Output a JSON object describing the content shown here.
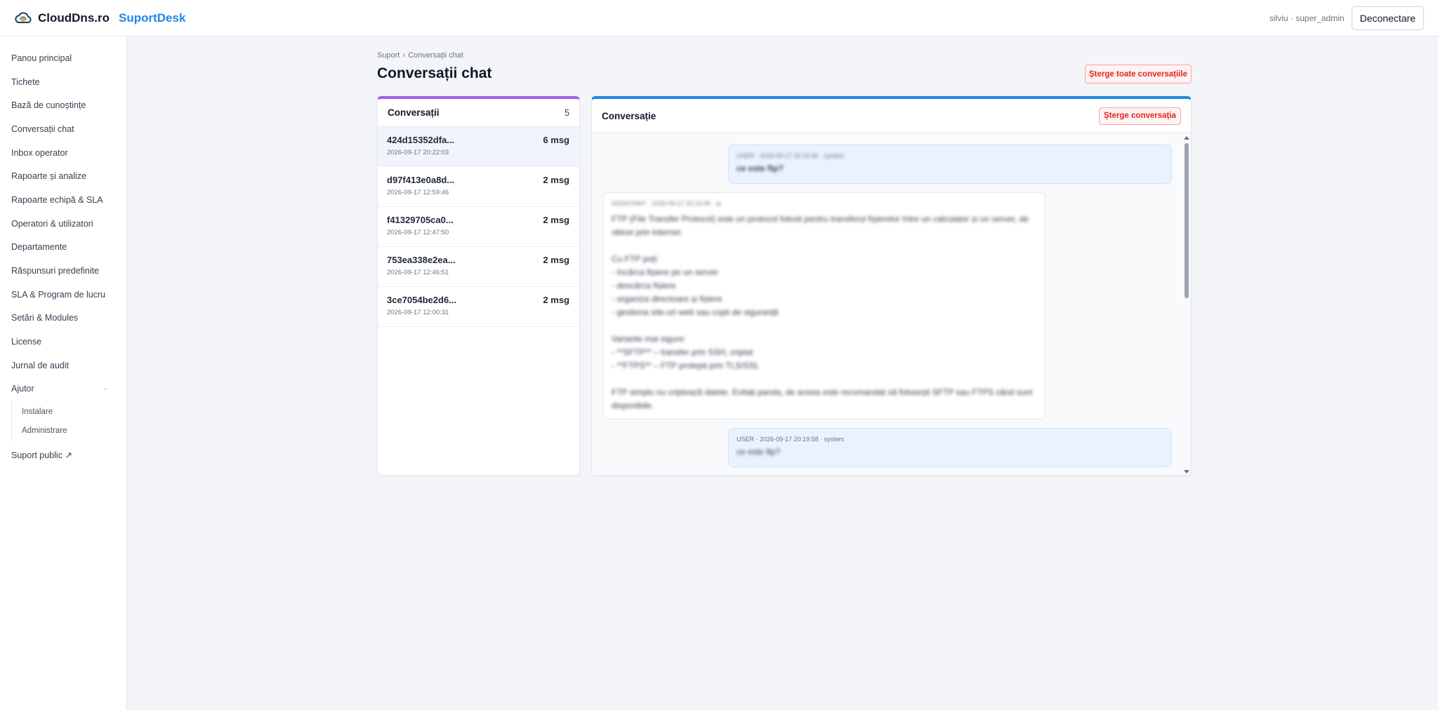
{
  "header": {
    "brand_name": "CloudDns.ro",
    "brand_accent": "SuportDesk",
    "user_info": "silviu · super_admin",
    "logout_label": "Deconectare"
  },
  "sidebar": {
    "items": [
      {
        "label": "Panou principal"
      },
      {
        "label": "Tichete"
      },
      {
        "label": "Bază de cunoștințe"
      },
      {
        "label": "Conversații chat"
      },
      {
        "label": "Inbox operator"
      },
      {
        "label": "Rapoarte și analize"
      },
      {
        "label": "Rapoarte echipă & SLA"
      },
      {
        "label": "Operatori & utilizatori"
      },
      {
        "label": "Departamente"
      },
      {
        "label": "Răspunsuri predefinite"
      },
      {
        "label": "SLA & Program de lucru"
      },
      {
        "label": "Setări & Modules"
      },
      {
        "label": "License"
      },
      {
        "label": "Jurnal de audit"
      }
    ],
    "help": {
      "label": "Ajutor",
      "caret": "-",
      "children": [
        "Instalare",
        "Administrare"
      ]
    },
    "public_support": "Suport public ↗"
  },
  "breadcrumb": {
    "root": "Suport",
    "separator": "›",
    "current": "Conversații chat"
  },
  "page_title": "Conversații chat",
  "delete_all_label": "Șterge toate conversațiile",
  "conversations": {
    "title": "Conversații",
    "count": "5",
    "items": [
      {
        "id": "424d15352dfa...",
        "count": "6 msg",
        "time": "2026-09-17 20:22:03",
        "active": true
      },
      {
        "id": "d97f413e0a8d...",
        "count": "2 msg",
        "time": "2026-09-17 12:59:46"
      },
      {
        "id": "f41329705ca0...",
        "count": "2 msg",
        "time": "2026-09-17 12:47:50"
      },
      {
        "id": "753ea338e2ea...",
        "count": "2 msg",
        "time": "2026-09-17 12:46:51"
      },
      {
        "id": "3ce7054be2d6...",
        "count": "2 msg",
        "time": "2026-09-17 12:00:31"
      }
    ]
  },
  "conversation_view": {
    "title": "Conversație",
    "delete_label": "Șterge conversația",
    "messages": [
      {
        "role": "user",
        "meta": "USER · 2026-09-17 20:19:45 · system",
        "text": "ce este ftp?"
      },
      {
        "role": "assistant",
        "meta": "ASSISTANT · 2026-09-17 20:19:49 · ai",
        "text": "FTP (File Transfer Protocol) este un protocol folosit pentru transferul fișierelor între un calculator și un server, de obicei prin internet.\n\nCu FTP poți:\n- încărca fișiere pe un server\n- descărca fișiere\n- organiza directoare și fișiere\n- gestiona site-uri web sau copii de siguranță\n\nVariante mai sigure:\n- **SFTP** – transfer prin SSH, criptat\n- **FTPS** – FTP protejat prin TLS/SSL\n\nFTP simplu nu criptează datele. Evitați parola, de aceea este recomandat să folosești SFTP sau FTPS când sunt disponibile."
      },
      {
        "role": "user",
        "meta": "USER · 2026-09-17 20:19:58 · system",
        "text": "ce este ftp?"
      }
    ]
  },
  "colors": {
    "brand_accent": "#1e88e5",
    "list_accent": "#a35de0",
    "view_accent": "#1e88e5",
    "danger": "#dc2626"
  },
  "icons": {
    "logo": "cloud-headset-icon"
  }
}
